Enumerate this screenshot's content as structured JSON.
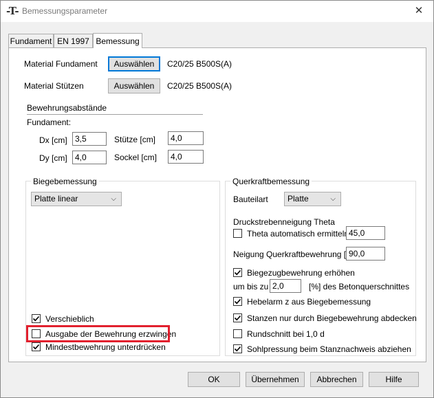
{
  "window": {
    "title": "Bemessungsparameter",
    "icon": "T-icon",
    "close": "✕"
  },
  "tabs": [
    {
      "label": "Fundament",
      "active": false
    },
    {
      "label": "EN 1997",
      "active": false
    },
    {
      "label": "Bemessung",
      "active": true
    }
  ],
  "material": {
    "fundament_label": "Material Fundament",
    "fundament_button": "Auswählen",
    "fundament_value": "C20/25 B500S(A)",
    "stuetzen_label": "Material Stützen",
    "stuetzen_button": "Auswählen",
    "stuetzen_value": "C20/25 B500S(A)"
  },
  "bewehrung": {
    "heading": "Bewehrungsabstände",
    "fundament_label": "Fundament:",
    "dx_label": "Dx [cm]",
    "dx_value": "3,5",
    "dy_label": "Dy [cm]",
    "dy_value": "4,0",
    "stuetze_label": "Stütze [cm]",
    "stuetze_value": "4,0",
    "sockel_label": "Sockel [cm]",
    "sockel_value": "4,0"
  },
  "biege": {
    "group_label": "Biegebemessung",
    "select_value": "Platte linear",
    "checkboxes": [
      {
        "label": "Verschieblich",
        "checked": true
      },
      {
        "label": "Ausgabe der Bewehrung erzwingen",
        "checked": false
      },
      {
        "label": "Mindestbewehrung unterdrücken",
        "checked": true
      }
    ]
  },
  "querkraft": {
    "group_label": "Querkraftbemessung",
    "bauteilart_label": "Bauteilart",
    "bauteilart_value": "Platte",
    "theta_heading": "Druckstrebenneigung Theta",
    "theta_auto_label": "Theta automatisch ermitteln",
    "theta_auto_checked": false,
    "theta_value": "45,0",
    "neigung_label": "Neigung Querkraftbewehrung [°]",
    "neigung_value": "90,0",
    "biegezug_label": "Biegezugbewehrung erhöhen",
    "biegezug_checked": true,
    "umbis_label": "um bis zu",
    "umbis_value": "2,0",
    "umbis_unit": "[%] des Betonquerschnittes",
    "hebelarm_label": "Hebelarm z aus Biegebemessung",
    "hebelarm_checked": true,
    "stanzen_label": "Stanzen nur durch Biegebewehrung abdecken",
    "stanzen_checked": true,
    "rundschnitt_label": "Rundschnitt bei 1,0 d",
    "rundschnitt_checked": false,
    "sohlpressung_label": "Sohlpressung beim Stanznachweis abziehen",
    "sohlpressung_checked": true
  },
  "footer": {
    "ok": "OK",
    "uebernehmen": "Übernehmen",
    "abbrechen": "Abbrechen",
    "hilfe": "Hilfe"
  }
}
